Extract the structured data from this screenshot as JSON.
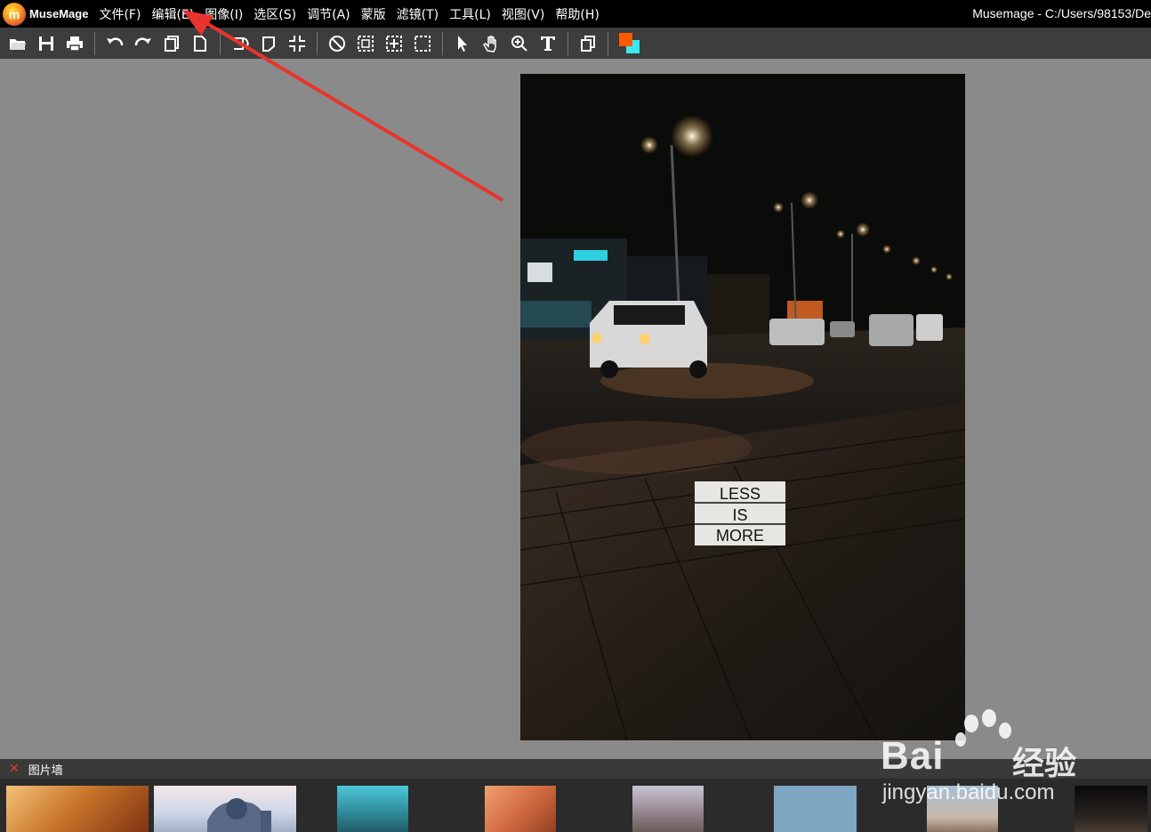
{
  "titlebar": {
    "app_name": "MuseMage",
    "logo_glyph": "m",
    "window_title": "Musemage - C:/Users/98153/De",
    "menu": [
      {
        "label": "文件(F)",
        "name": "menu-file"
      },
      {
        "label": "编辑(E)",
        "name": "menu-edit"
      },
      {
        "label": "图像(I)",
        "name": "menu-image"
      },
      {
        "label": "选区(S)",
        "name": "menu-select"
      },
      {
        "label": "调节(A)",
        "name": "menu-adjust"
      },
      {
        "label": "蒙版",
        "name": "menu-mask"
      },
      {
        "label": "滤镜(T)",
        "name": "menu-filter"
      },
      {
        "label": "工具(L)",
        "name": "menu-tools"
      },
      {
        "label": "视图(V)",
        "name": "menu-view"
      },
      {
        "label": "帮助(H)",
        "name": "menu-help"
      }
    ]
  },
  "toolbar": {
    "icons": [
      "open-icon",
      "save-icon",
      "print-icon",
      "undo-icon",
      "redo-icon",
      "copy-icon",
      "new-icon",
      "rotate-left-icon",
      "rotate-right-icon",
      "crop-icon",
      "deselect-icon",
      "rect-select-icon",
      "transform-select-icon",
      "marquee-icon",
      "pointer-icon",
      "hand-icon",
      "zoom-icon",
      "text-icon",
      "layers-icon"
    ],
    "foreground_color": "#ff5a00",
    "background_color": "#3de8f0"
  },
  "photo": {
    "sign_lines": [
      "LESS",
      "IS",
      "MORE"
    ]
  },
  "image_wall": {
    "title": "图片墙",
    "close_glyph": "✕"
  },
  "watermark": {
    "brand": "Bai",
    "brand_cn": "经验",
    "url": "jingyan.baidu.com"
  },
  "colors": {
    "annotation_arrow": "#e8342c",
    "canvas_bg": "#8a8a8a"
  }
}
